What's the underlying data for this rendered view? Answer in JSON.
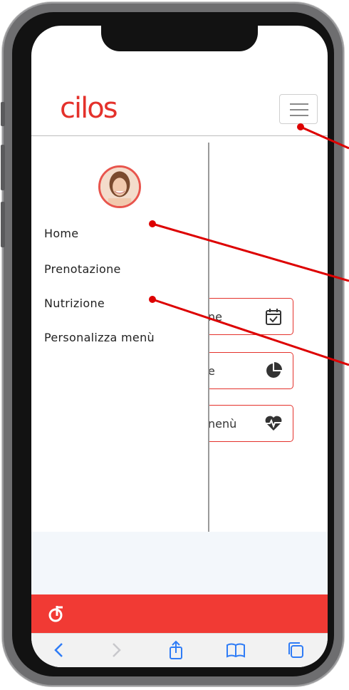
{
  "app": {
    "logo_text": "cilos",
    "brand_color": "#e4312b"
  },
  "header": {
    "menu_icon": "hamburger-menu-icon"
  },
  "drawer": {
    "avatar": "user-avatar",
    "items": [
      {
        "label": "Home"
      },
      {
        "label": "Prenotazione"
      },
      {
        "label": "Nutrizione"
      },
      {
        "label": "Personalizza menù"
      }
    ]
  },
  "cards": [
    {
      "label": "ne",
      "icon": "calendar-check-icon"
    },
    {
      "label": "e",
      "icon": "pie-chart-icon"
    },
    {
      "label": "nenù",
      "icon": "heartbeat-icon"
    }
  ],
  "footer": {
    "bar_color": "#f13a34",
    "icon": "app-logo-icon"
  },
  "browser_toolbar": {
    "icons": [
      "back-icon",
      "forward-icon",
      "share-icon",
      "bookmarks-icon",
      "tabs-icon"
    ]
  },
  "annotation_color": "#dd0000"
}
